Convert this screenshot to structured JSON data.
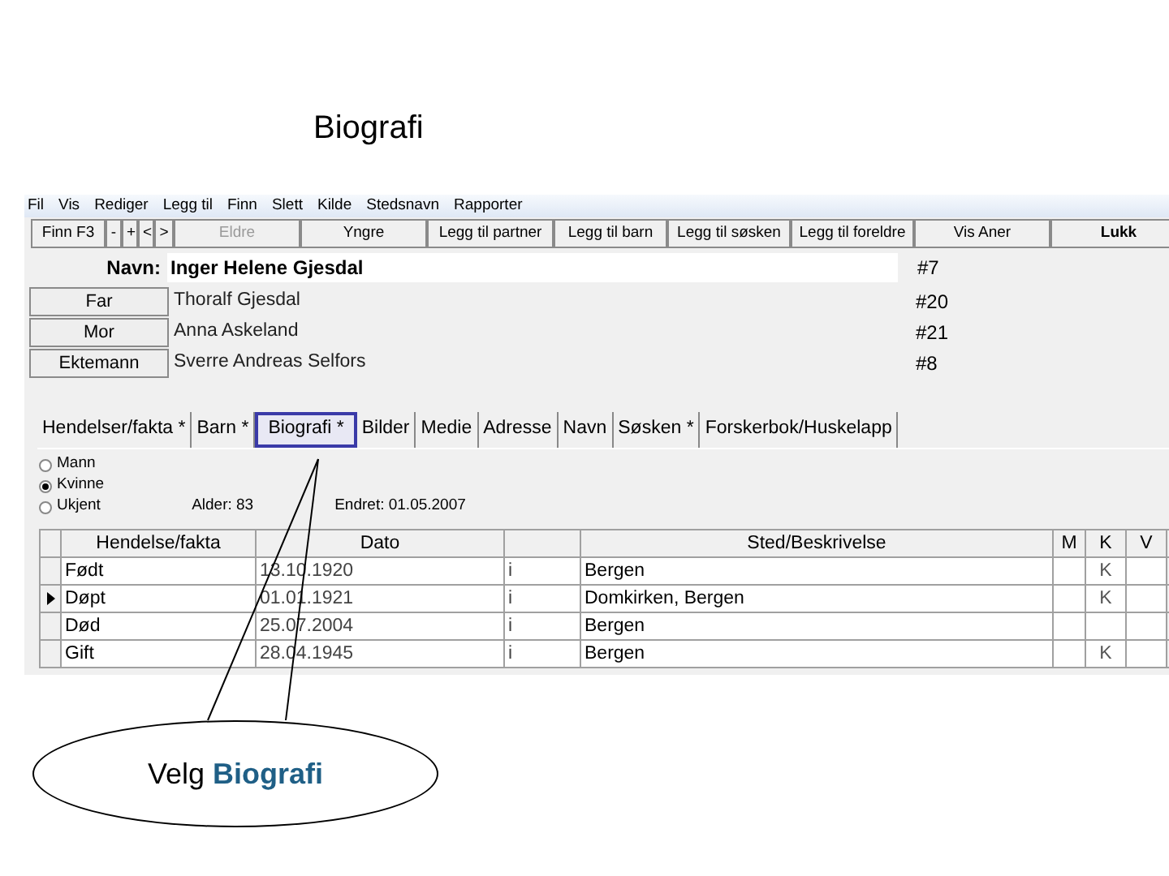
{
  "slide_title": "Biografi",
  "menu": [
    "Fil",
    "Vis",
    "Rediger",
    "Legg til",
    "Finn",
    "Slett",
    "Kilde",
    "Stedsnavn",
    "Rapporter"
  ],
  "toolbar": [
    {
      "label": "Finn  F3",
      "disabled": false,
      "bold": false
    },
    {
      "label": "-",
      "disabled": false,
      "bold": false
    },
    {
      "label": "+",
      "disabled": false,
      "bold": false
    },
    {
      "label": "<",
      "disabled": false,
      "bold": false
    },
    {
      "label": ">",
      "disabled": false,
      "bold": false
    },
    {
      "label": "Eldre",
      "disabled": true,
      "bold": false
    },
    {
      "label": "Yngre",
      "disabled": false,
      "bold": false
    },
    {
      "label": "Legg til partner",
      "disabled": false,
      "bold": false
    },
    {
      "label": "Legg til barn",
      "disabled": false,
      "bold": false
    },
    {
      "label": "Legg til søsken",
      "disabled": false,
      "bold": false
    },
    {
      "label": "Legg til foreldre",
      "disabled": false,
      "bold": false
    },
    {
      "label": "Vis Aner",
      "disabled": false,
      "bold": false
    },
    {
      "label": "Lukk",
      "disabled": false,
      "bold": true
    }
  ],
  "name_label": "Navn:",
  "name_value": "Inger Helene Gjesdal",
  "name_number": "#7",
  "relatives": [
    {
      "button": "Far",
      "name": "Thoralf Gjesdal",
      "number": "#20"
    },
    {
      "button": "Mor",
      "name": "Anna Askeland",
      "number": "#21"
    },
    {
      "button": "Ektemann",
      "name": "Sverre Andreas Selfors",
      "number": "#8"
    }
  ],
  "tabs": [
    {
      "label": "Hendelser/fakta *",
      "highlighted": false
    },
    {
      "label": "Barn *",
      "highlighted": false
    },
    {
      "label": "Biografi *",
      "highlighted": true
    },
    {
      "label": "Bilder",
      "highlighted": false
    },
    {
      "label": "Medie",
      "highlighted": false
    },
    {
      "label": "Adresse",
      "highlighted": false
    },
    {
      "label": "Navn",
      "highlighted": false
    },
    {
      "label": "Søsken *",
      "highlighted": false
    },
    {
      "label": "Forskerbok/Huskelapp",
      "highlighted": false
    }
  ],
  "gender": [
    {
      "label": "Mann",
      "selected": false
    },
    {
      "label": "Kvinne",
      "selected": true
    },
    {
      "label": "Ukjent",
      "selected": false
    }
  ],
  "age": "Alder: 83",
  "changed": "Endret: 01.05.2007",
  "columns": {
    "event": "Hendelse/fakta",
    "date": "Dato",
    "place": "Sted/Beskrivelse",
    "m": "M",
    "k": "K",
    "v": "V"
  },
  "rows": [
    {
      "event": "Født",
      "date": "13.10.1920",
      "column_3": "i",
      "place": "Bergen",
      "k": "K",
      "current": false
    },
    {
      "event": "Døpt",
      "date": "01.01.1921",
      "column_3": "i",
      "place": "Domkirken, Bergen",
      "k": "K",
      "current": true
    },
    {
      "event": "Død",
      "date": "25.07.2004",
      "column_3": "i",
      "place": "Bergen",
      "current": false
    },
    {
      "event": "Gift",
      "date": "28.04.1945",
      "column_3": "i",
      "place": "Bergen",
      "k": "K",
      "current": false
    }
  ],
  "callout": "Velg **Biografi**"
}
